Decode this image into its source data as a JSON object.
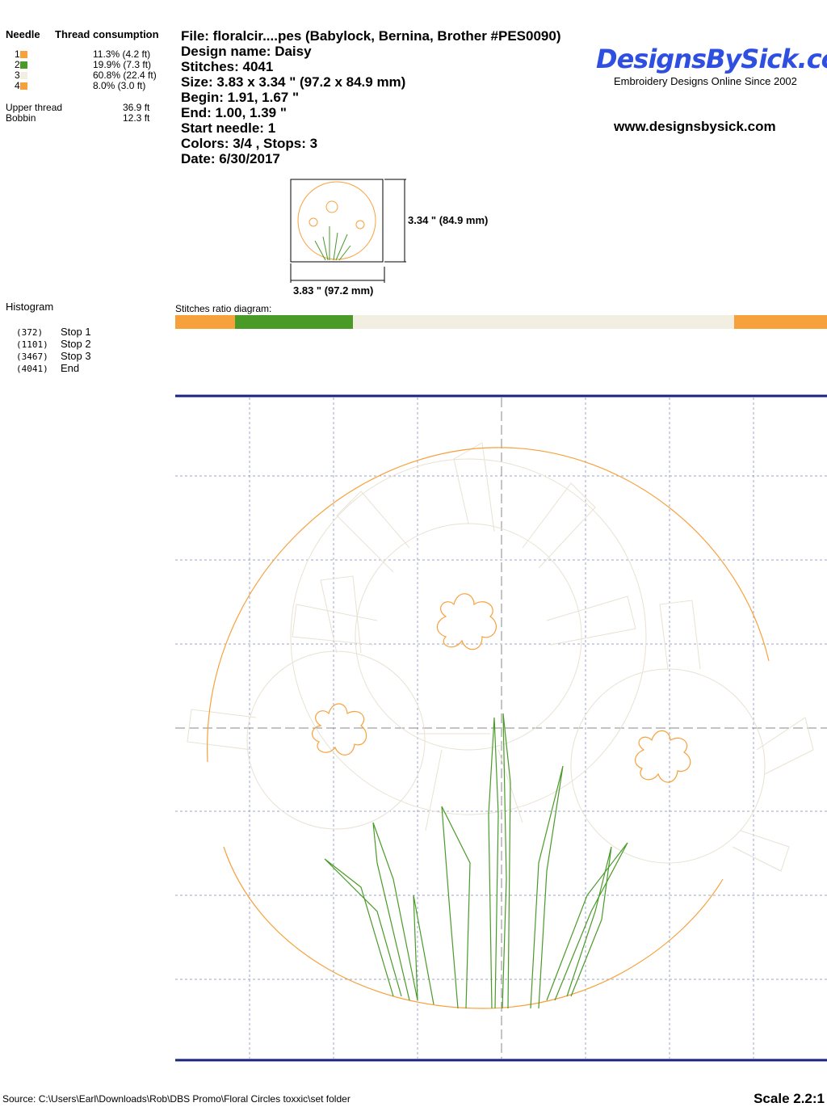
{
  "consumption": {
    "needle_header": "Needle",
    "thread_header": "Thread consumption",
    "needles": [
      {
        "num": "1",
        "color": "#f7a13d",
        "pct": "11.3% (4.2 ft)"
      },
      {
        "num": "2",
        "color": "#4a9a28",
        "pct": "19.9% (7.3 ft)"
      },
      {
        "num": "3",
        "color": "#f2eee1",
        "pct": "60.8% (22.4 ft)"
      },
      {
        "num": "4",
        "color": "#f7a13d",
        "pct": "8.0% (3.0 ft)"
      }
    ],
    "upper_label": "Upper thread",
    "upper_value": "36.9 ft",
    "bobbin_label": "Bobbin",
    "bobbin_value": "12.3 ft"
  },
  "info": {
    "file": "File: floralcir....pes  (Babylock, Bernina, Brother #PES0090)",
    "design_name": "Design name: Daisy",
    "stitches": "Stitches: 4041",
    "size": "Size: 3.83 x 3.34 \" (97.2 x 84.9 mm)",
    "begin": "Begin: 1.91, 1.67 \"",
    "end": "End: 1.00, 1.39 \"",
    "start_needle": "Start needle: 1",
    "colors": "Colors: 3/4 , Stops: 3",
    "date": "Date: 6/30/2017"
  },
  "brand": {
    "logo": "DesignsBySick.com",
    "tagline": "Embroidery Designs Online Since 2002",
    "url": "www.designsbysick.com"
  },
  "dimensions": {
    "height": "3.34 \" (84.9 mm)",
    "width": "3.83 \" (97.2 mm)"
  },
  "histogram": {
    "title": "Histogram",
    "rows": [
      {
        "count": "(372)",
        "label": "Stop 1"
      },
      {
        "count": "(1101)",
        "label": "Stop 2"
      },
      {
        "count": "(3467)",
        "label": "Stop 3"
      },
      {
        "count": "(4041)",
        "label": "End"
      }
    ]
  },
  "ratio": {
    "label": "Stitches ratio diagram:",
    "segments": [
      {
        "color": "#f7a13d",
        "fraction": 0.092
      },
      {
        "color": "#4a9a28",
        "fraction": 0.181
      },
      {
        "color": "#f2eee1",
        "fraction": 0.585
      },
      {
        "color": "#f7a13d",
        "fraction": 0.142
      }
    ]
  },
  "footer": {
    "source": "Source: C:\\Users\\Earl\\Downloads\\Rob\\DBS Promo\\Floral Circles  toxxic\\set folder",
    "scale": "Scale 2.2:1"
  },
  "colors": {
    "orange": "#f7a13d",
    "green": "#4a9a28",
    "cream": "#e9e2d3",
    "grid": "#9ea6c8",
    "frame": "#1a237e"
  }
}
